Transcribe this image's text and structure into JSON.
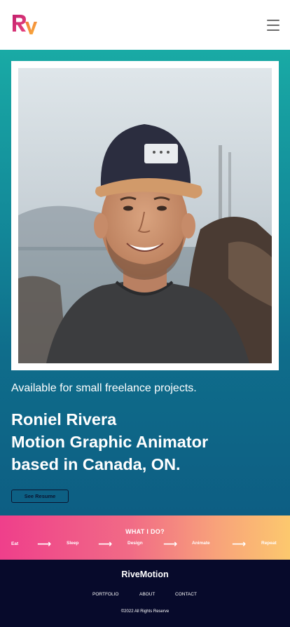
{
  "header": {
    "logo_text": "RV",
    "menu_icon": "hamburger-menu-icon"
  },
  "hero": {
    "photo_alt": "Portrait photo",
    "tagline": "Available for small freelance projects.",
    "headline_lines": [
      "Roniel Rivera",
      "Motion Graphic Animator",
      "based in Canada, ON."
    ],
    "resume_button": "See Resume"
  },
  "what_i_do": {
    "title": "WHAT I DO?",
    "steps": [
      "Eat",
      "Sleep",
      "Design",
      "Animate",
      "Repeat"
    ],
    "arrow_icon": "arrow-right-icon"
  },
  "footer": {
    "brand": "RiveMotion",
    "nav": [
      "PORTFOLIO",
      "ABOUT",
      "CONTACT"
    ],
    "copyright": "©2022 All Rights Reserve"
  },
  "colors": {
    "hero_top": "#19aaa5",
    "hero_bottom": "#0d5e83",
    "band_left": "#ef3f8b",
    "band_right": "#fcc86e",
    "footer_bg": "#070a2b",
    "logo_r": "#e0337f",
    "logo_v": "#f7a23a"
  }
}
